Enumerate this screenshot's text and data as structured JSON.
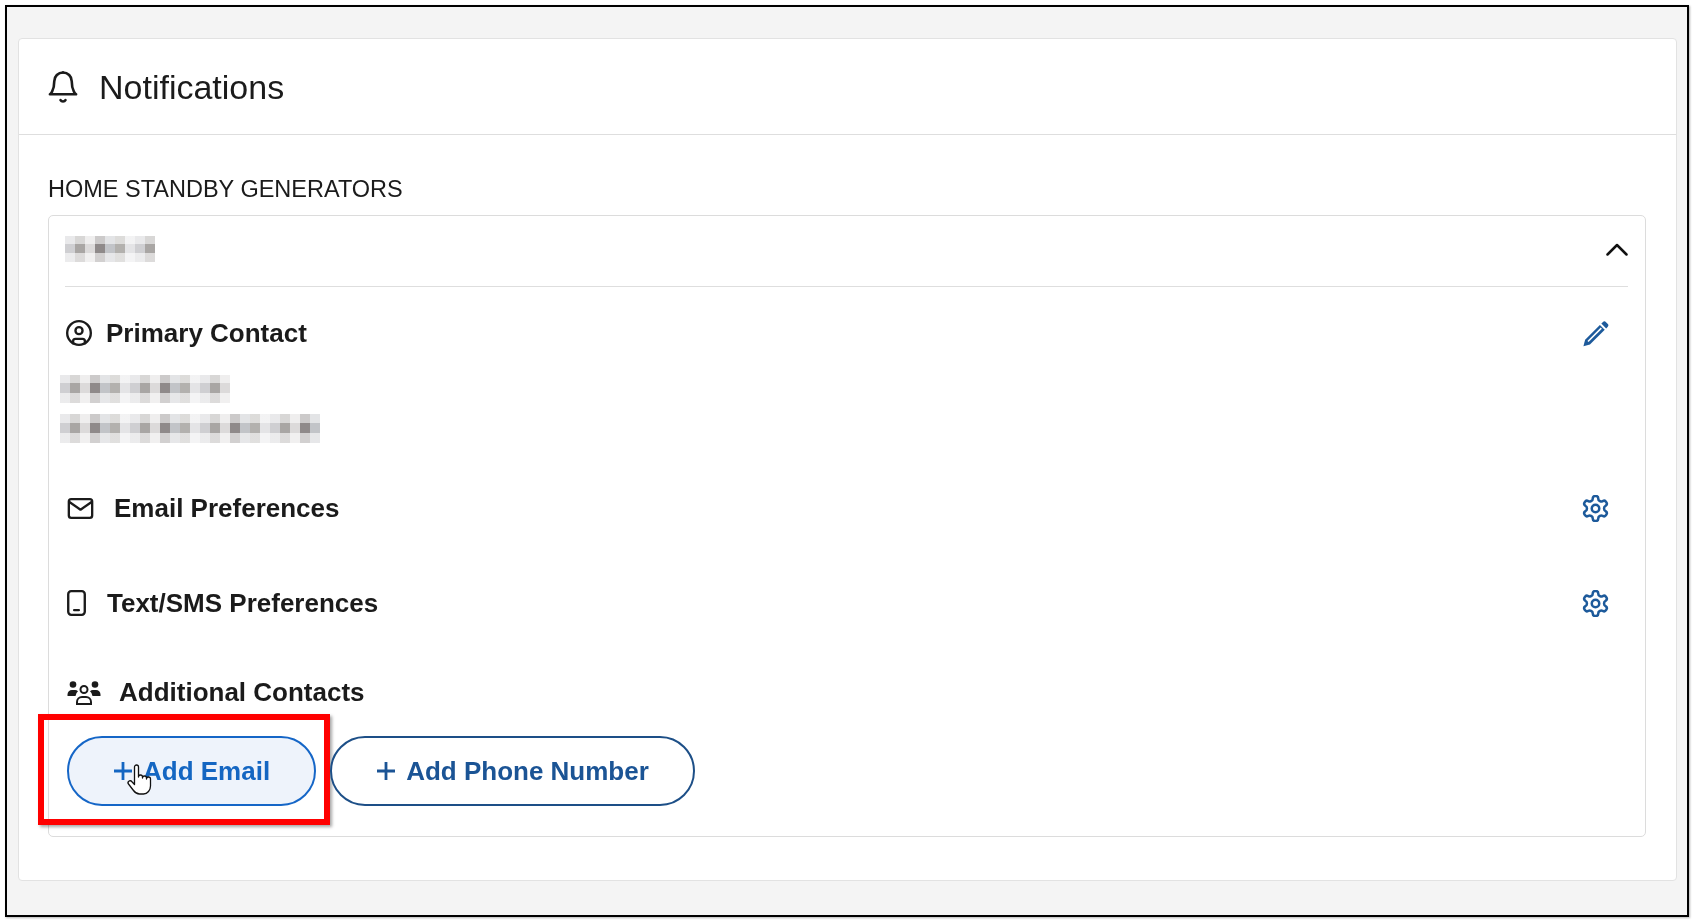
{
  "header": {
    "title": "Notifications"
  },
  "group": {
    "label": "HOME STANDBY GENERATORS"
  },
  "panel": {
    "expanded": true,
    "sections": [
      {
        "kind": "primary",
        "title": "Primary Contact"
      },
      {
        "kind": "email",
        "title": "Email Preferences"
      },
      {
        "kind": "sms",
        "title": "Text/SMS Preferences"
      },
      {
        "kind": "additional",
        "title": "Additional Contacts"
      }
    ],
    "buttons": [
      {
        "label": "Add Email",
        "hovered": true,
        "highlighted": true
      },
      {
        "label": "Add Phone Number",
        "hovered": false,
        "highlighted": false
      }
    ]
  }
}
